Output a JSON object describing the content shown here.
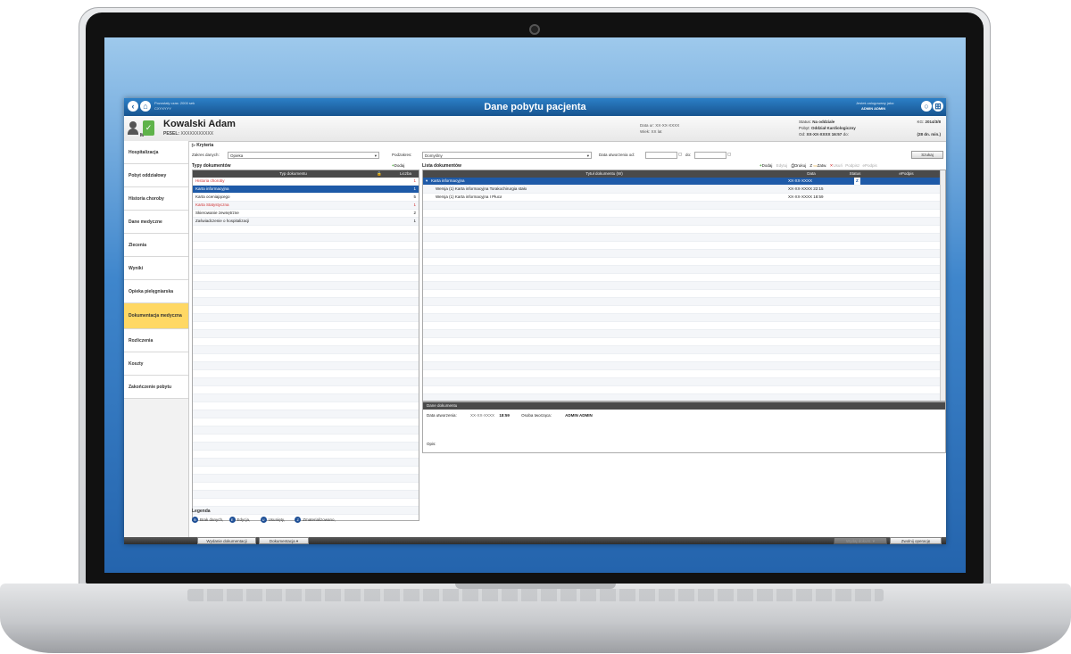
{
  "window": {
    "title": "Dane pobytu pacjenta",
    "top_left_label": "Pozostały czas: 2000 sek",
    "top_left_sub": "CXYXYYY",
    "top_right_label": "Jesteś zalogowany jako:",
    "top_right_user": "ADMIN ADMIN",
    "left_button_icons": [
      "back-icon",
      "home-icon"
    ],
    "right_button_icons": [
      "circle-icon",
      "grid-icon"
    ]
  },
  "patient": {
    "name": "Kowalski Adam",
    "pesel_label": "PESEL:",
    "pesel_value": "XXXXXXXXXXX",
    "gender": "M",
    "dob_label": "Data ur:",
    "dob_value": "XX-XX-XXXX",
    "age_label": "Wiek:",
    "age_value": "XX lat",
    "status_label": "Status:",
    "status_value": "Na oddziale",
    "ward_label": "Pobyt:",
    "ward_value": "Oddział Kardiologiczny",
    "from_label": "Od:",
    "from_value": "XX-XX-XXXX 16:57",
    "to_label": "do:",
    "ks_label": "KG:",
    "ks_value": "2014/3/8",
    "duration": "(28 dn. min.)"
  },
  "sidebar": {
    "items": [
      {
        "label": "Hospitalizacja",
        "active": false
      },
      {
        "label": "Pobyt oddziałowy",
        "active": false
      },
      {
        "label": "Historia choroby",
        "active": false
      },
      {
        "label": "Dane medyczne",
        "active": false
      },
      {
        "label": "Zlecenia",
        "active": false
      },
      {
        "label": "Wyniki",
        "active": false
      },
      {
        "label": "Opieka pielęgniarska",
        "active": false
      },
      {
        "label": "Dokumentacja medyczna",
        "active": true
      },
      {
        "label": "Rozliczenia",
        "active": false
      },
      {
        "label": "Koszty",
        "active": false
      },
      {
        "label": "Zakończenie pobytu",
        "active": false
      }
    ]
  },
  "criteria": {
    "title": "Kryteria",
    "range_label": "Zakres danych:",
    "range_value": "Opieka",
    "sub_label": "Podzakres:",
    "sub_value": "Domyślny",
    "date_from_label": "Data utworzenia od:",
    "date_to_label": "do:",
    "search_button": "Szukaj"
  },
  "doc_types": {
    "title": "Typy dokumentów",
    "add_label": "Dodaj",
    "columns": [
      "Typ dokumentu",
      "Liczba"
    ],
    "rows": [
      {
        "name": "Historia choroby",
        "count": "1",
        "red": true,
        "selected": false
      },
      {
        "name": "Karta informacyjna",
        "count": "1",
        "red": false,
        "selected": true
      },
      {
        "name": "Karta oceniającego",
        "count": "5",
        "red": false,
        "selected": false
      },
      {
        "name": "Karta Statystyczna",
        "count": "1",
        "red": true,
        "selected": false
      },
      {
        "name": "Skierowanie zewnętrzne",
        "count": "2",
        "red": false,
        "selected": false
      },
      {
        "name": "Zaświadczenie o hospitalizacji",
        "count": "1",
        "red": false,
        "selected": false
      }
    ]
  },
  "doc_list": {
    "title": "Lista dokumentów",
    "toolbar": [
      "Dodaj",
      "Edytuj",
      "Drukuj",
      "Z",
      "Zatw.",
      "Usuń",
      "Podpisz",
      "ePodpis"
    ],
    "columns": [
      "Tytuł dokumentu (W)",
      "Data",
      "Status",
      "ePodpis"
    ],
    "rows": [
      {
        "title": "Karta informacyjna",
        "date": "XX-XX-XXXX",
        "status": "Z",
        "selected": true
      },
      {
        "title": "Wersja (1) Karta informacyjna Torakochirurgia stało",
        "date": "XX-XX-XXXX 22:15",
        "status": "",
        "selected": false
      },
      {
        "title": "Wersja (1) Karta informacyjna I Płuca",
        "date": "XX-XX-XXXX 18:59",
        "status": "",
        "selected": false
      }
    ]
  },
  "details": {
    "title": "Dane dokumentu",
    "created_label": "Data utworzenia:",
    "created_value": "XX-XX-XXXX",
    "created_time": "18:59",
    "author_label": "Osoba tworząca:",
    "author_value": "ADMIN ADMIN",
    "desc_label": "Opis:"
  },
  "legend": {
    "title": "Legenda",
    "items": [
      {
        "mark": "B",
        "label": "Brak danych,"
      },
      {
        "mark": "E",
        "label": "Edycja,"
      },
      {
        "mark": "U",
        "label": "Usunięty,"
      },
      {
        "mark": "Z",
        "label": "Zmaterializowano,"
      }
    ]
  },
  "bottom": {
    "issue_button": "Wydanie dokumentacji",
    "docs_button": "Dokumentacja",
    "disabled_button": "Wydaj dokum.",
    "release_button": "Zwolnij operację"
  },
  "colors": {
    "titlebar": "#1d63a8",
    "selected_row": "#1e5aa8",
    "active_nav": "#ffd864",
    "red_text": "#d03030",
    "accent_green": "#5fb34a"
  }
}
